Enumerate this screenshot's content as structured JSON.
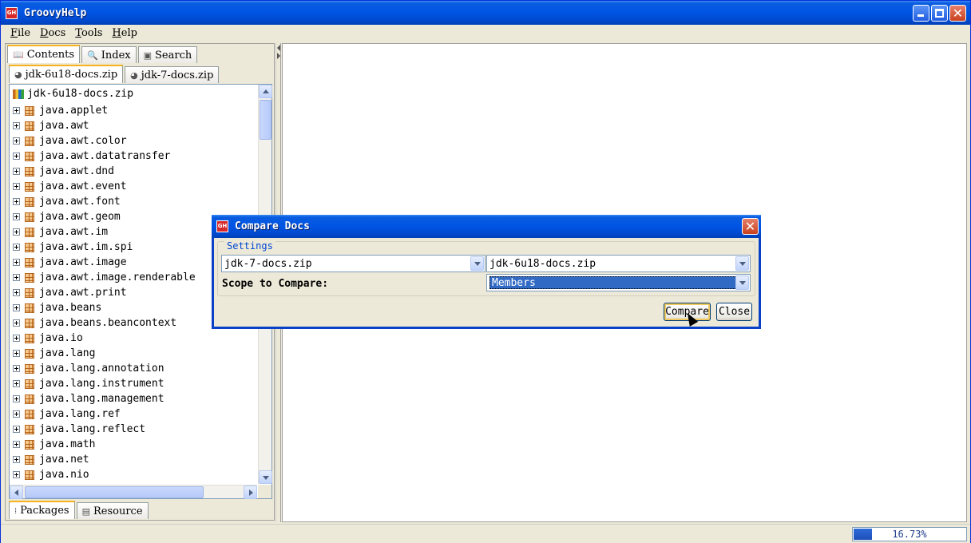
{
  "window": {
    "title": "GroovyHelp",
    "icon_label": "GH"
  },
  "menu": {
    "file": {
      "mnemonic": "F",
      "rest": "ile"
    },
    "docs": {
      "mnemonic": "D",
      "rest": "ocs"
    },
    "tools": {
      "mnemonic": "T",
      "rest": "ools"
    },
    "help": {
      "mnemonic": "H",
      "rest": "elp"
    }
  },
  "left_tabs": [
    "Contents",
    "Index",
    "Search"
  ],
  "doc_tabs": [
    "jdk-6u18-docs.zip",
    "jdk-7-docs.zip"
  ],
  "tree": {
    "root": "jdk-6u18-docs.zip",
    "items": [
      "java.applet",
      "java.awt",
      "java.awt.color",
      "java.awt.datatransfer",
      "java.awt.dnd",
      "java.awt.event",
      "java.awt.font",
      "java.awt.geom",
      "java.awt.im",
      "java.awt.im.spi",
      "java.awt.image",
      "java.awt.image.renderable",
      "java.awt.print",
      "java.beans",
      "java.beans.beancontext",
      "java.io",
      "java.lang",
      "java.lang.annotation",
      "java.lang.instrument",
      "java.lang.management",
      "java.lang.ref",
      "java.lang.reflect",
      "java.math",
      "java.net",
      "java.nio"
    ]
  },
  "bottom_tabs": [
    "Packages",
    "Resource"
  ],
  "status": {
    "progress_text": "16.73%",
    "progress_fraction": 0.1673
  },
  "dialog": {
    "title": "Compare Docs",
    "settings_legend": "Settings",
    "left_doc": "jdk-7-docs.zip",
    "right_doc": "jdk-6u18-docs.zip",
    "scope_label": "Scope to Compare:",
    "scope_value": "Members",
    "compare_button": "Compare",
    "close_button": "Close"
  }
}
